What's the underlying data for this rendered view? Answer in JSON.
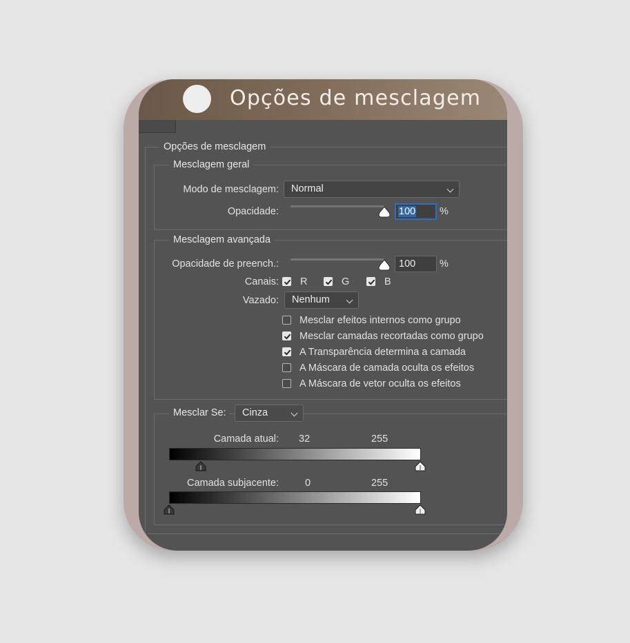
{
  "header": {
    "title": "Opções de mesclagem"
  },
  "section": {
    "title": "Opções de mesclagem"
  },
  "general": {
    "title": "Mesclagem geral",
    "mode_label": "Modo de mesclagem:",
    "mode_value": "Normal",
    "opacity_label": "Opacidade:",
    "opacity_value": "100",
    "opacity_level": 100,
    "percent": "%"
  },
  "advanced": {
    "title": "Mesclagem avançada",
    "fill_label": "Opacidade de preench.:",
    "fill_value": "100",
    "fill_level": 100,
    "percent": "%",
    "channels_label": "Canais:",
    "channels": [
      {
        "label": "R",
        "checked": true
      },
      {
        "label": "G",
        "checked": true
      },
      {
        "label": "B",
        "checked": true
      }
    ],
    "knockout_label": "Vazado:",
    "knockout_value": "Nenhum",
    "options": [
      {
        "label": "Mesclar efeitos internos como grupo",
        "checked": false
      },
      {
        "label": "Mesclar camadas recortadas como grupo",
        "checked": true
      },
      {
        "label": "A Transparência determina a camada",
        "checked": true
      },
      {
        "label": "A Máscara de camada oculta os efeitos",
        "checked": false
      },
      {
        "label": "A Máscara de vetor oculta os efeitos",
        "checked": false
      }
    ]
  },
  "blend_if": {
    "label": "Mesclar Se:",
    "value": "Cinza",
    "this_layer": {
      "label": "Camada atual:",
      "low": "32",
      "high": "255"
    },
    "underlying": {
      "label": "Camada subjacente:",
      "low": "0",
      "high": "255"
    }
  }
}
